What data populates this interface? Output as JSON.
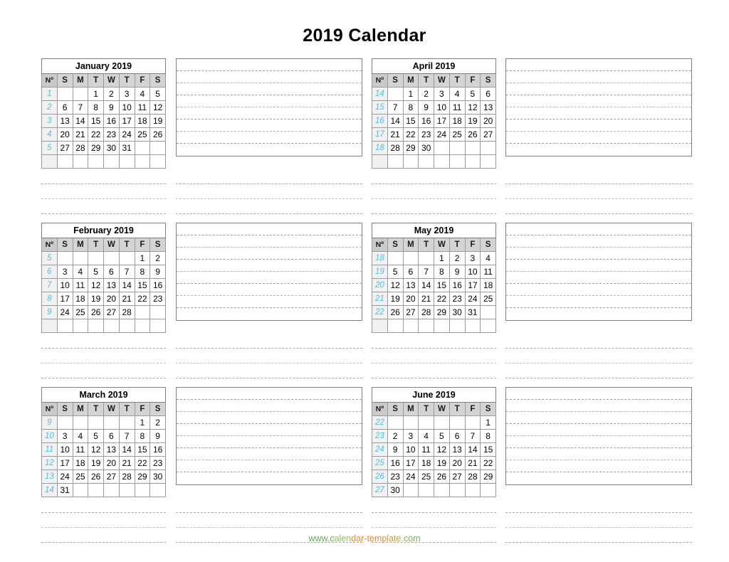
{
  "page": {
    "title": "2019 Calendar",
    "footer_text": "www.calendar-template.com",
    "accent_week_color": "#4fbfe0",
    "header_bg_color": "#d4d4d4"
  },
  "calendar": {
    "weekday_headers": [
      "Nº",
      "S",
      "M",
      "T",
      "W",
      "T",
      "F",
      "S"
    ],
    "months": [
      {
        "name": "January 2019",
        "weeks": [
          {
            "no": "1",
            "days": [
              "",
              "",
              "1",
              "2",
              "3",
              "4",
              "5"
            ]
          },
          {
            "no": "2",
            "days": [
              "6",
              "7",
              "8",
              "9",
              "10",
              "11",
              "12"
            ]
          },
          {
            "no": "3",
            "days": [
              "13",
              "14",
              "15",
              "16",
              "17",
              "18",
              "19"
            ]
          },
          {
            "no": "4",
            "days": [
              "20",
              "21",
              "22",
              "23",
              "24",
              "25",
              "26"
            ]
          },
          {
            "no": "5",
            "days": [
              "27",
              "28",
              "29",
              "30",
              "31",
              "",
              ""
            ]
          },
          {
            "no": "",
            "days": [
              "",
              "",
              "",
              "",
              "",
              "",
              ""
            ]
          }
        ]
      },
      {
        "name": "February 2019",
        "weeks": [
          {
            "no": "5",
            "days": [
              "",
              "",
              "",
              "",
              "",
              "1",
              "2"
            ]
          },
          {
            "no": "6",
            "days": [
              "3",
              "4",
              "5",
              "6",
              "7",
              "8",
              "9"
            ]
          },
          {
            "no": "7",
            "days": [
              "10",
              "11",
              "12",
              "13",
              "14",
              "15",
              "16"
            ]
          },
          {
            "no": "8",
            "days": [
              "17",
              "18",
              "19",
              "20",
              "21",
              "22",
              "23"
            ]
          },
          {
            "no": "9",
            "days": [
              "24",
              "25",
              "26",
              "27",
              "28",
              "",
              ""
            ]
          },
          {
            "no": "",
            "days": [
              "",
              "",
              "",
              "",
              "",
              "",
              ""
            ]
          }
        ]
      },
      {
        "name": "March 2019",
        "weeks": [
          {
            "no": "9",
            "days": [
              "",
              "",
              "",
              "",
              "",
              "1",
              "2"
            ]
          },
          {
            "no": "10",
            "days": [
              "3",
              "4",
              "5",
              "6",
              "7",
              "8",
              "9"
            ]
          },
          {
            "no": "11",
            "days": [
              "10",
              "11",
              "12",
              "13",
              "14",
              "15",
              "16"
            ]
          },
          {
            "no": "12",
            "days": [
              "17",
              "18",
              "19",
              "20",
              "21",
              "22",
              "23"
            ]
          },
          {
            "no": "13",
            "days": [
              "24",
              "25",
              "26",
              "27",
              "28",
              "29",
              "30"
            ]
          },
          {
            "no": "14",
            "days": [
              "31",
              "",
              "",
              "",
              "",
              "",
              ""
            ]
          }
        ]
      },
      {
        "name": "April 2019",
        "weeks": [
          {
            "no": "14",
            "days": [
              "",
              "1",
              "2",
              "3",
              "4",
              "5",
              "6"
            ]
          },
          {
            "no": "15",
            "days": [
              "7",
              "8",
              "9",
              "10",
              "11",
              "12",
              "13"
            ]
          },
          {
            "no": "16",
            "days": [
              "14",
              "15",
              "16",
              "17",
              "18",
              "19",
              "20"
            ]
          },
          {
            "no": "17",
            "days": [
              "21",
              "22",
              "23",
              "24",
              "25",
              "26",
              "27"
            ]
          },
          {
            "no": "18",
            "days": [
              "28",
              "29",
              "30",
              "",
              "",
              "",
              ""
            ]
          },
          {
            "no": "",
            "days": [
              "",
              "",
              "",
              "",
              "",
              "",
              ""
            ]
          }
        ]
      },
      {
        "name": "May 2019",
        "weeks": [
          {
            "no": "18",
            "days": [
              "",
              "",
              "",
              "1",
              "2",
              "3",
              "4"
            ]
          },
          {
            "no": "19",
            "days": [
              "5",
              "6",
              "7",
              "8",
              "9",
              "10",
              "11"
            ]
          },
          {
            "no": "20",
            "days": [
              "12",
              "13",
              "14",
              "15",
              "16",
              "17",
              "18"
            ]
          },
          {
            "no": "21",
            "days": [
              "19",
              "20",
              "21",
              "22",
              "23",
              "24",
              "25"
            ]
          },
          {
            "no": "22",
            "days": [
              "26",
              "27",
              "28",
              "29",
              "30",
              "31",
              ""
            ]
          },
          {
            "no": "",
            "days": [
              "",
              "",
              "",
              "",
              "",
              "",
              ""
            ]
          }
        ]
      },
      {
        "name": "June 2019",
        "weeks": [
          {
            "no": "22",
            "days": [
              "",
              "",
              "",
              "",
              "",
              "",
              "1"
            ]
          },
          {
            "no": "23",
            "days": [
              "2",
              "3",
              "4",
              "5",
              "6",
              "7",
              "8"
            ]
          },
          {
            "no": "24",
            "days": [
              "9",
              "10",
              "11",
              "12",
              "13",
              "14",
              "15"
            ]
          },
          {
            "no": "25",
            "days": [
              "16",
              "17",
              "18",
              "19",
              "20",
              "21",
              "22"
            ]
          },
          {
            "no": "26",
            "days": [
              "23",
              "24",
              "25",
              "26",
              "27",
              "28",
              "29"
            ]
          },
          {
            "no": "27",
            "days": [
              "30",
              "",
              "",
              "",
              "",
              "",
              ""
            ]
          }
        ]
      }
    ],
    "notes_lines_per_box": 8,
    "rules_below_band": 3
  }
}
